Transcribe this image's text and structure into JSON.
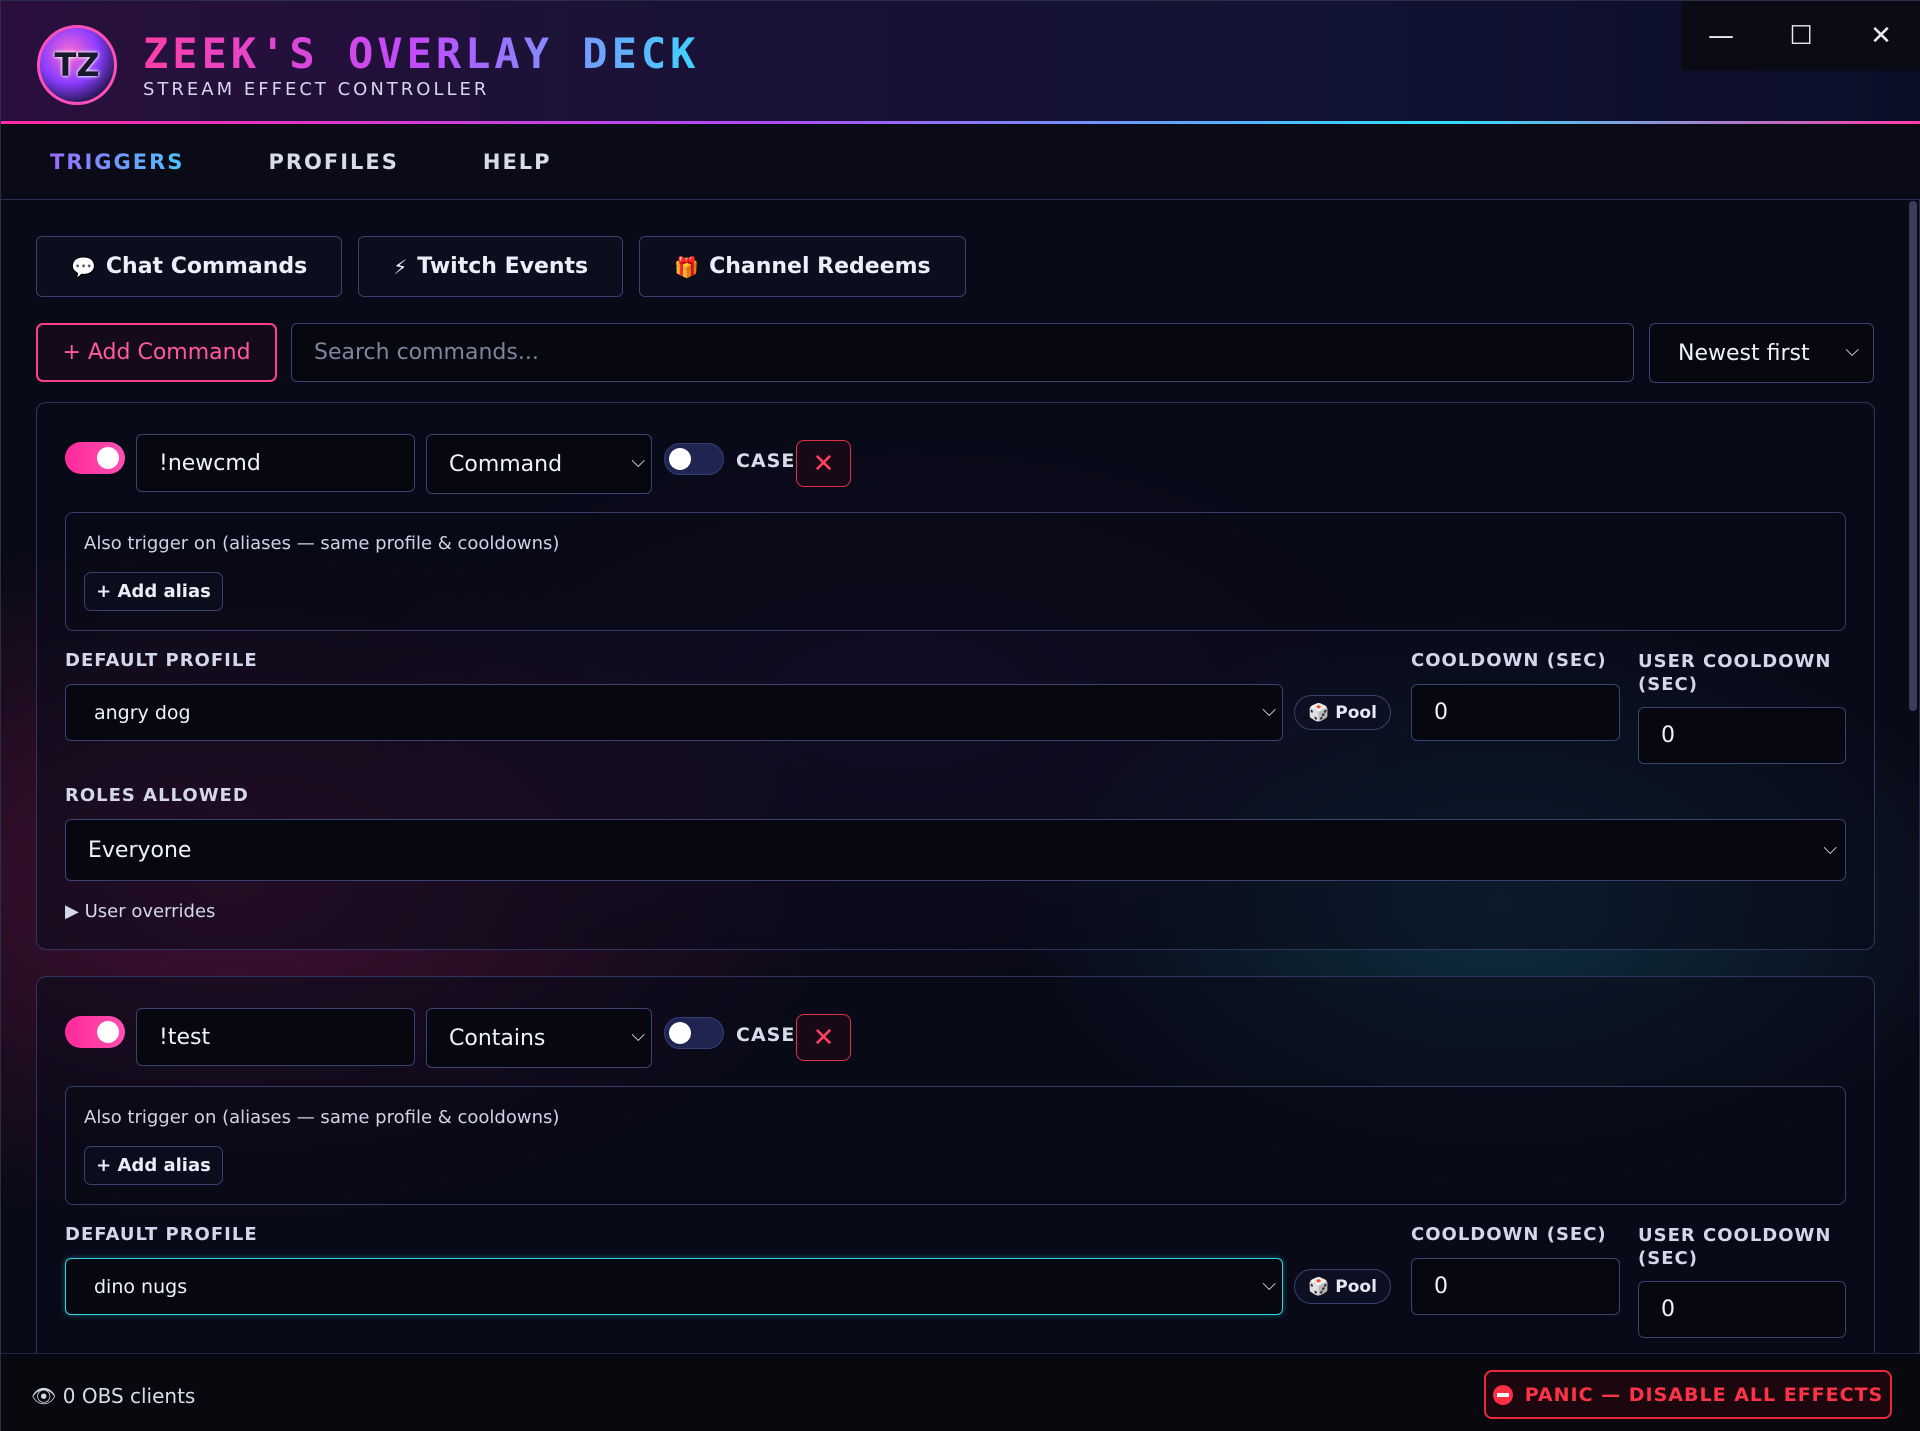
{
  "app": {
    "logo_text": "TZ",
    "title": "ZEEK'S OVERLAY DECK",
    "subtitle": "STREAM EFFECT CONTROLLER"
  },
  "window_controls": {
    "minimize": "—",
    "maximize": "☐",
    "close": "✕"
  },
  "nav": {
    "tabs": [
      {
        "label": "TRIGGERS",
        "active": true
      },
      {
        "label": "PROFILES"
      },
      {
        "label": "HELP"
      }
    ]
  },
  "category_tabs": [
    {
      "icon": "speech-bubble-icon",
      "glyph": "💬",
      "label": "Chat Commands"
    },
    {
      "icon": "lightning-icon",
      "glyph": "⚡",
      "label": "Twitch Events"
    },
    {
      "icon": "gift-icon",
      "glyph": "🎁",
      "label": "Channel Redeems"
    }
  ],
  "toolbar": {
    "add_label": "+ Add Command",
    "search_placeholder": "Search commands...",
    "sort_value": "Newest first"
  },
  "commands": [
    {
      "enabled": true,
      "trigger": "!newcmd",
      "match_type": "Command",
      "case_sensitive": false,
      "case_label": "CASE",
      "alias_label": "Also trigger on (aliases — same profile & cooldowns)",
      "alias_button": "+ Add alias",
      "default_profile_label": "DEFAULT PROFILE",
      "default_profile": "angry dog",
      "pool_label": "Pool",
      "cooldown_label": "COOLDOWN (SEC)",
      "cooldown": "0",
      "user_cooldown_label": "USER COOLDOWN (SEC)",
      "user_cooldown": "0",
      "roles_label": "ROLES ALLOWED",
      "roles": "Everyone",
      "overrides_label": "▶ User overrides"
    },
    {
      "enabled": true,
      "trigger": "!test",
      "match_type": "Contains",
      "case_sensitive": false,
      "case_label": "CASE",
      "alias_label": "Also trigger on (aliases — same profile & cooldowns)",
      "alias_button": "+ Add alias",
      "default_profile_label": "DEFAULT PROFILE",
      "default_profile": "dino nugs",
      "pool_label": "Pool",
      "cooldown_label": "COOLDOWN (SEC)",
      "cooldown": "0",
      "user_cooldown_label": "USER COOLDOWN (SEC)",
      "user_cooldown": "0"
    }
  ],
  "footer": {
    "obs_status": "0 OBS clients",
    "panic_label": "PANIC — DISABLE ALL EFFECTS"
  },
  "colors": {
    "accent_pink": "#ff2a9a",
    "accent_cyan": "#2de0ff",
    "danger": "#ff3347",
    "background": "#090a17"
  }
}
